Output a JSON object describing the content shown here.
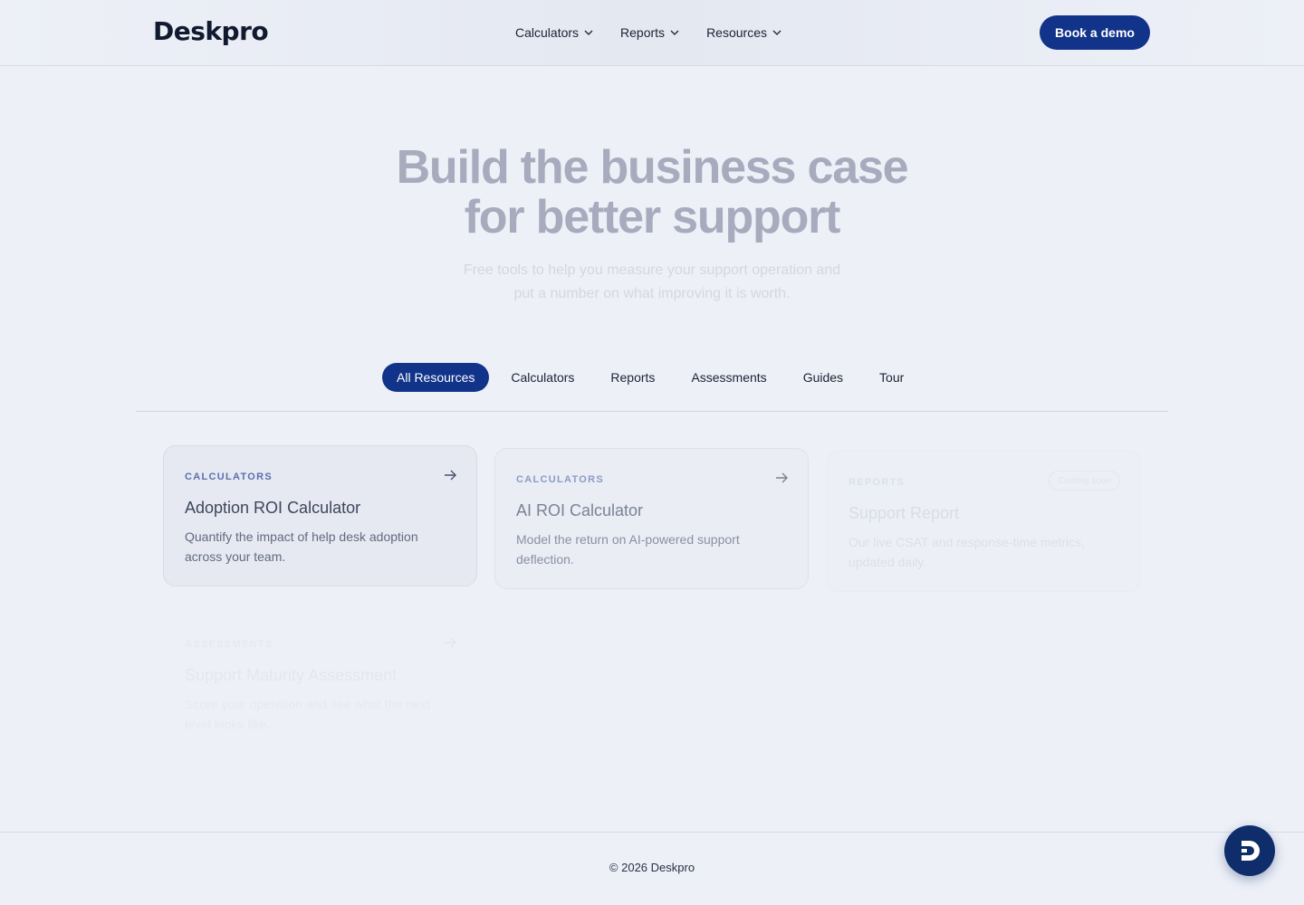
{
  "brand": {
    "logo": "Deskpro"
  },
  "nav": {
    "items": [
      {
        "label": "Calculators",
        "icon": "chevron-down-icon"
      },
      {
        "label": "Reports",
        "icon": "chevron-down-icon"
      },
      {
        "label": "Resources",
        "icon": "chevron-down-icon"
      }
    ],
    "cta": "Book a demo"
  },
  "hero": {
    "title_line1": "Build the business case",
    "title_line2": "for better support",
    "subtitle_line1": "Free tools to help you measure your support operation and",
    "subtitle_line2": "put a number on what improving it is worth."
  },
  "filters": {
    "tabs": [
      "All Resources",
      "Calculators",
      "Reports",
      "Assessments",
      "Guides",
      "Tour"
    ],
    "active": "All Resources"
  },
  "cards": [
    {
      "category": "CALCULATORS",
      "title": "Adoption ROI Calculator",
      "desc_line1": "Quantify the impact of help desk adoption",
      "desc_line2": "across your team.",
      "icon": "arrow-right-icon"
    },
    {
      "category": "CALCULATORS",
      "title": "AI ROI Calculator",
      "desc_line1": "Model the return on AI-powered support",
      "desc_line2": "deflection.",
      "icon": "arrow-right-icon"
    },
    {
      "category": "REPORTS",
      "title": "Support Report",
      "badge": "Coming soon",
      "desc_line1": "Our live CSAT and response-time metrics,",
      "desc_line2": "updated daily."
    },
    {
      "category": "ASSESSMENTS",
      "title": "Support Maturity Assessment",
      "desc_line1": "Score your operation and see what the next",
      "desc_line2": "level looks like.",
      "icon": "arrow-right-icon"
    }
  ],
  "footer": {
    "copyright": "© 2026 Deskpro"
  },
  "chat": {
    "icon": "deskpro-chat-icon"
  },
  "colors": {
    "primary": "#12338a",
    "background": "#edf0f7",
    "chat": "#0f2d6b"
  }
}
